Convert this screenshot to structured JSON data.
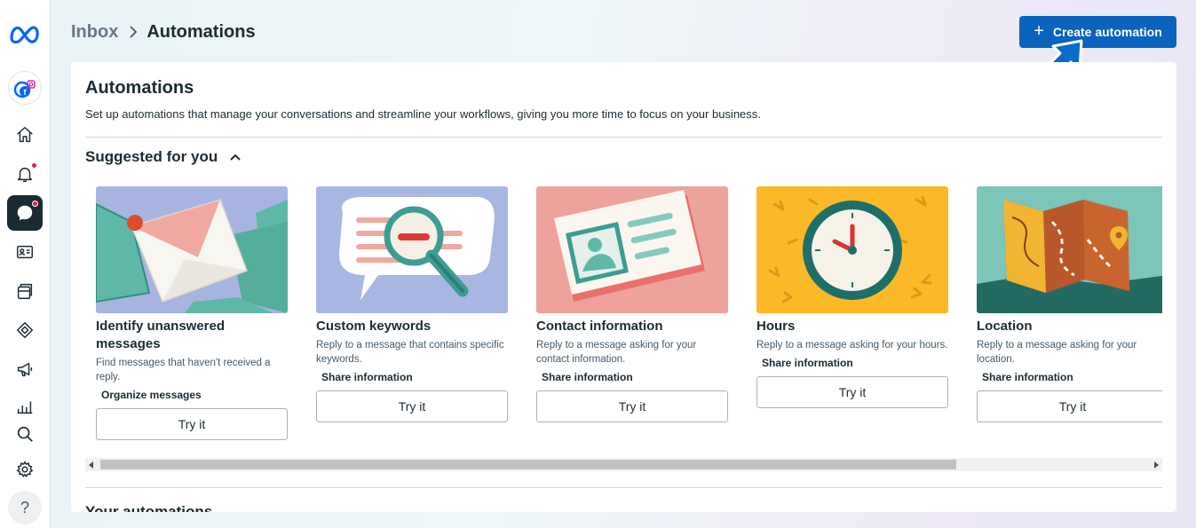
{
  "header": {
    "breadcrumb_root": "Inbox",
    "breadcrumb_current": "Automations",
    "create_label": "Create automation"
  },
  "card": {
    "title": "Automations",
    "description": "Set up automations that manage your conversations and streamline your workflows, giving you more time to focus on your business.",
    "suggested_title": "Suggested for you",
    "your_title": "Your automations"
  },
  "tiles": [
    {
      "title": "Identify unanswered messages",
      "desc": "Find messages that haven't received a reply.",
      "tag": "Organize messages",
      "button": "Try it"
    },
    {
      "title": "Custom keywords",
      "desc": "Reply to a message that contains specific keywords.",
      "tag": "Share information",
      "button": "Try it"
    },
    {
      "title": "Contact information",
      "desc": "Reply to a message asking for your contact information.",
      "tag": "Share information",
      "button": "Try it"
    },
    {
      "title": "Hours",
      "desc": "Reply to a message asking for your hours.",
      "tag": "Share information",
      "button": "Try it"
    },
    {
      "title": "Location",
      "desc": "Reply to a message asking for your location.",
      "tag": "Share information",
      "button": "Try it"
    }
  ],
  "sidebar": {
    "icons": [
      "meta-logo",
      "account-icon",
      "home-icon",
      "notifications-icon",
      "inbox-icon",
      "contacts-icon",
      "content-icon",
      "ads-icon",
      "marketing-icon",
      "insights-icon",
      "search-icon",
      "settings-icon",
      "help-icon"
    ],
    "help_glyph": "?"
  },
  "colors": {
    "primary": "#0a63bc",
    "dark": "#1c2b33",
    "alert_dot": "#e41e3f"
  }
}
